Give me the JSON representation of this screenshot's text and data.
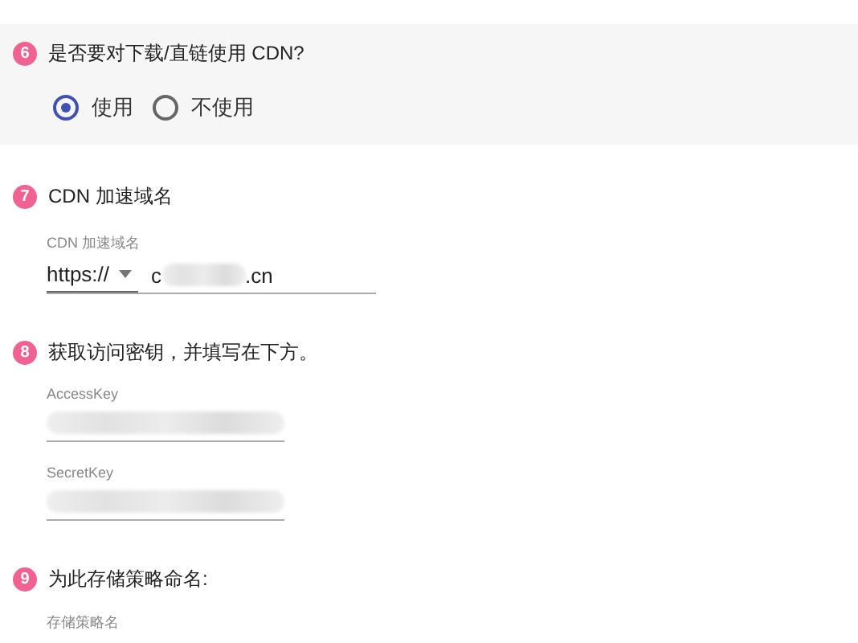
{
  "steps": [
    {
      "number": "6",
      "title": "是否要对下载/直链使用 CDN?",
      "highlighted": true,
      "kind": "radio",
      "options": [
        {
          "label": "使用",
          "selected": true
        },
        {
          "label": "不使用",
          "selected": false
        }
      ]
    },
    {
      "number": "7",
      "title": "CDN 加速域名",
      "highlighted": false,
      "kind": "domain",
      "field": {
        "label": "CDN 加速域名",
        "protocol": "https://",
        "value_start": "c",
        "value_end": ".cn"
      }
    },
    {
      "number": "8",
      "title": "获取访问密钥，并填写在下方。",
      "highlighted": false,
      "kind": "keys",
      "fields": [
        {
          "label": "AccessKey"
        },
        {
          "label": "SecretKey"
        }
      ]
    },
    {
      "number": "9",
      "title": "为此存储策略命名:",
      "highlighted": false,
      "kind": "name",
      "field": {
        "label": "存储策略名"
      }
    }
  ]
}
